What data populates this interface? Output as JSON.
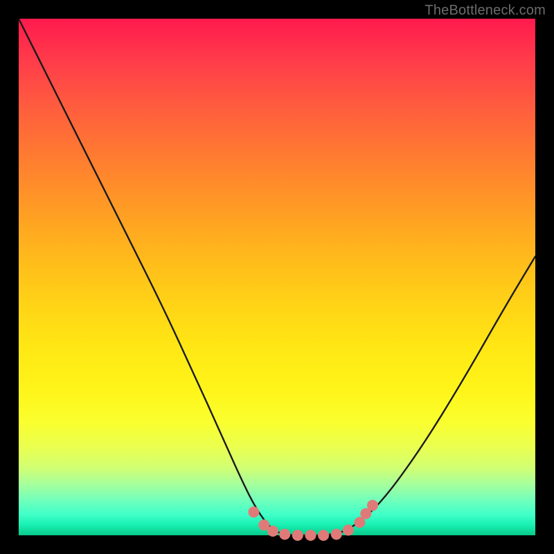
{
  "watermark": "TheBottleneck.com",
  "colors": {
    "background": "#000000",
    "curve_stroke": "#1a1a1a",
    "marker_fill": "#e07a78",
    "watermark": "#6c6c6c"
  },
  "chart_data": {
    "type": "line",
    "title": "",
    "xlabel": "",
    "ylabel": "",
    "xlim": [
      0,
      1
    ],
    "ylim": [
      0,
      1
    ],
    "series": [
      {
        "name": "bottleneck-curve",
        "x": [
          0.0,
          0.07,
          0.14,
          0.21,
          0.28,
          0.34,
          0.39,
          0.43,
          0.46,
          0.49,
          0.52,
          0.56,
          0.6,
          0.64,
          0.7,
          0.78,
          0.86,
          0.94,
          1.0
        ],
        "values": [
          1.0,
          0.86,
          0.72,
          0.58,
          0.44,
          0.31,
          0.2,
          0.11,
          0.05,
          0.01,
          0.0,
          0.0,
          0.0,
          0.01,
          0.06,
          0.17,
          0.3,
          0.44,
          0.54
        ]
      }
    ],
    "markers": [
      {
        "x": 0.455,
        "y": 0.045
      },
      {
        "x": 0.475,
        "y": 0.02
      },
      {
        "x": 0.492,
        "y": 0.008
      },
      {
        "x": 0.515,
        "y": 0.002
      },
      {
        "x": 0.54,
        "y": 0.0
      },
      {
        "x": 0.565,
        "y": 0.0
      },
      {
        "x": 0.59,
        "y": 0.0
      },
      {
        "x": 0.615,
        "y": 0.002
      },
      {
        "x": 0.638,
        "y": 0.01
      },
      {
        "x": 0.66,
        "y": 0.025
      },
      {
        "x": 0.672,
        "y": 0.042
      },
      {
        "x": 0.685,
        "y": 0.058
      }
    ]
  }
}
